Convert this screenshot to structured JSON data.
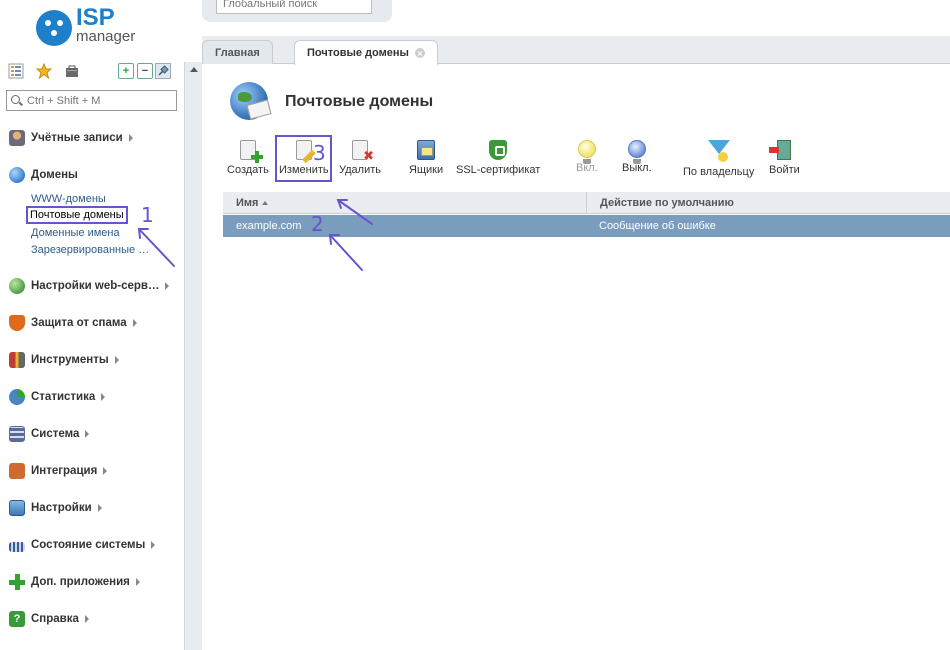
{
  "logo": {
    "brand": "ISP",
    "product": "manager"
  },
  "sidebar": {
    "search_placeholder": "Ctrl + Shift + M",
    "menu": [
      {
        "label": "Учётные записи",
        "color": "#c97c3a"
      },
      {
        "label": "Домены",
        "color": "#3a7fc9"
      },
      {
        "label": "Настройки web-серв…",
        "color": "#4a9e4a"
      },
      {
        "label": "Защита от спама",
        "color": "#e06a1a"
      },
      {
        "label": "Инструменты",
        "color": "#c03c30"
      },
      {
        "label": "Статистика",
        "color": "#4a84c4"
      },
      {
        "label": "Система",
        "color": "#5a6a9a"
      },
      {
        "label": "Интеграция",
        "color": "#d06a30"
      },
      {
        "label": "Настройки",
        "color": "#3a78b0"
      },
      {
        "label": "Состояние системы",
        "color": "#3a5a9a"
      },
      {
        "label": "Доп. приложения",
        "color": "#2fa52f"
      },
      {
        "label": "Справка",
        "color": "#3a9a3a"
      }
    ],
    "domains_sub": [
      "WWW-домены",
      "Почтовые домены",
      "Доменные имена",
      "Зарезервированные …"
    ]
  },
  "topbar": {
    "global_search_placeholder": "Глобальный поиск"
  },
  "tabs": [
    {
      "label": "Главная"
    },
    {
      "label": "Почтовые домены"
    }
  ],
  "page": {
    "title": "Почтовые домены"
  },
  "toolbar": {
    "create": "Создать",
    "edit": "Изменить",
    "delete": "Удалить",
    "boxes": "Ящики",
    "ssl": "SSL-сертификат",
    "enable": "Вкл.",
    "disable": "Выкл.",
    "by_owner": "По владельцу",
    "enter": "Войти"
  },
  "grid": {
    "columns": [
      "Имя",
      "Действие по умолчанию"
    ],
    "rows": [
      {
        "name": "example.com",
        "action": "Сообщение об ошибке"
      }
    ]
  },
  "annotations": {
    "n1": "1",
    "n2": "2",
    "n3": "3",
    "color": "#6655cc"
  }
}
